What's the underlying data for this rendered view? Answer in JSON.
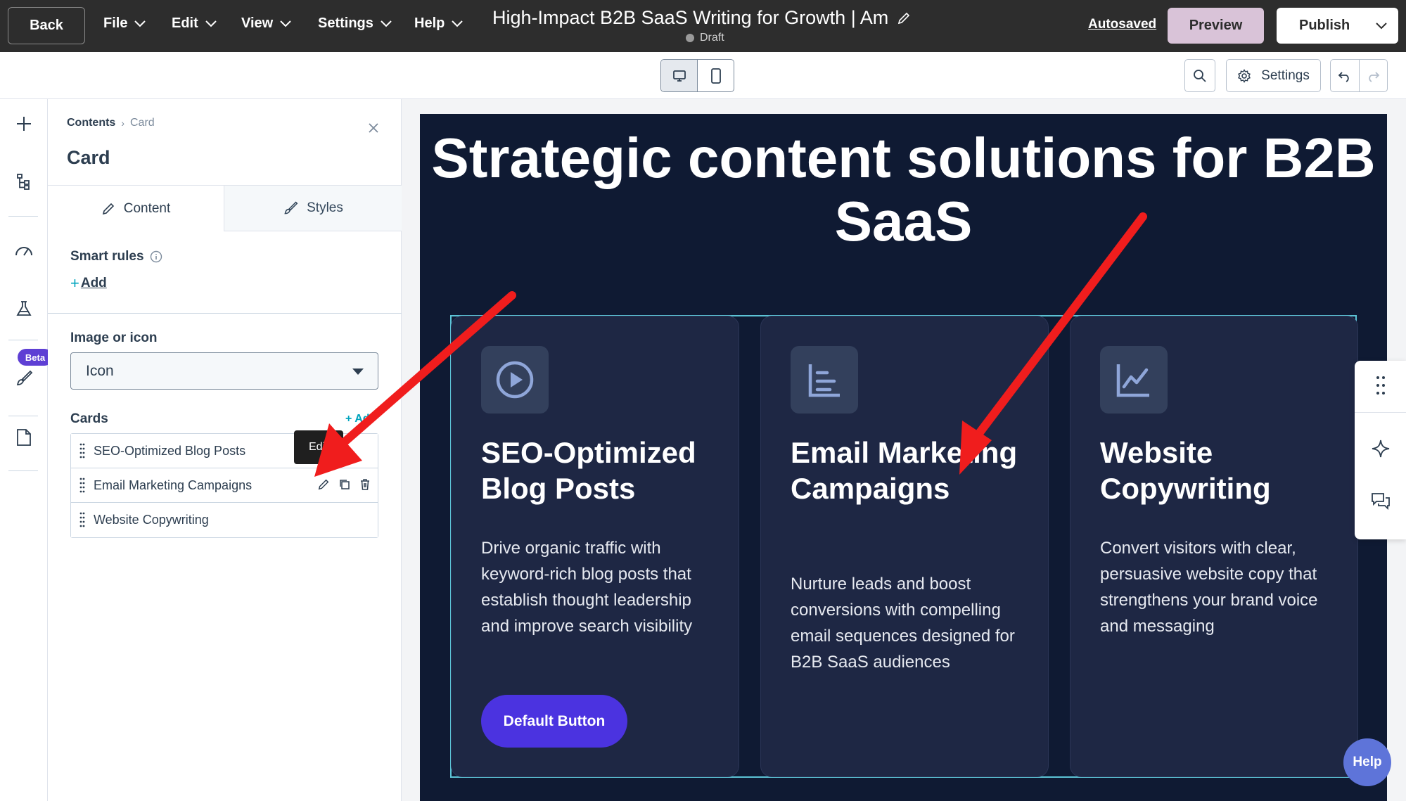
{
  "topbar": {
    "back_label": "Back",
    "menus": [
      "File",
      "Edit",
      "View",
      "Settings",
      "Help"
    ],
    "doc_title": "High-Impact B2B SaaS Writing for Growth | Am",
    "doc_status": "Draft",
    "autosaved_label": "Autosaved",
    "preview_label": "Preview",
    "publish_label": "Publish"
  },
  "toolbar": {
    "settings_label": "Settings"
  },
  "rail": {
    "beta_label": "Beta",
    "icons": [
      "plus-icon",
      "tree-icon",
      "gauge-icon",
      "flask-icon",
      "brush-icon",
      "page-icon"
    ]
  },
  "panel": {
    "breadcrumb": {
      "root": "Contents",
      "current": "Card"
    },
    "title": "Card",
    "tabs": {
      "content": "Content",
      "styles": "Styles"
    },
    "smart_rules_label": "Smart rules",
    "smart_rules_add": "Add",
    "image_label": "Image or icon",
    "image_value": "Icon",
    "cards_label": "Cards",
    "cards_add": "+ Add",
    "cards": [
      {
        "label": "SEO-Optimized Blog Posts"
      },
      {
        "label": "Email Marketing Campaigns"
      },
      {
        "label": "Website Copywriting"
      }
    ],
    "tooltip": "Edit"
  },
  "canvas": {
    "hero_title": "Strategic content solutions for B2B SaaS",
    "cards": [
      {
        "icon": "play-circle-icon",
        "title": "SEO-Optimized Blog Posts",
        "description": "Drive organic traffic with keyword-rich blog posts that establish thought leadership and improve search visibility",
        "button": "Default Button"
      },
      {
        "icon": "list-icon",
        "title": "Email Marketing Campaigns",
        "description": "Nurture leads and boost conversions with compelling email sequences designed for B2B SaaS audiences"
      },
      {
        "icon": "line-chart-icon",
        "title": "Website Copywriting",
        "description": "Convert visitors with clear, persuasive website copy that strengthens your brand voice and messaging"
      }
    ],
    "help_label": "Help"
  },
  "colors": {
    "hero_bg": "#0f1a33",
    "card_bg": "#1e2744",
    "button_bg": "#4b33e0",
    "annotation_arrow": "#f01d1d",
    "frame_outline": "#5cc3d6"
  }
}
